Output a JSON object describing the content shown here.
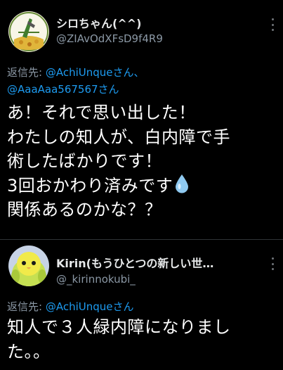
{
  "tweet1": {
    "display_name": "シロちゃん(^^)",
    "handle": "@ZIAvOdXFsD9f4R9",
    "reply_label": "返信先: ",
    "reply_mention1": "@AchiUnqueさん、",
    "reply_mention2": "@AaaAaa567567さん",
    "body_lines": [
      "あ！それで思い出した！",
      "わたしの知人が、白内障で手",
      "術したばかりです！",
      "3回おかわり済みです",
      "関係あるのかな？？"
    ],
    "emoji": "droplet-icon"
  },
  "tweet2": {
    "display_name": "Kirin(もうひとつの新しい世…",
    "handle": "@_kirinnokubi_",
    "reply_label": "返信先: ",
    "reply_mention": "@AchiUnqueさん",
    "body_lines": [
      "知人で３人緑内障になりまし",
      "た。。"
    ]
  },
  "colors": {
    "background": "#000000",
    "text": "#ffffff",
    "secondary": "#8b98a5",
    "link": "#1d9bf0",
    "divider": "#2f3336"
  }
}
